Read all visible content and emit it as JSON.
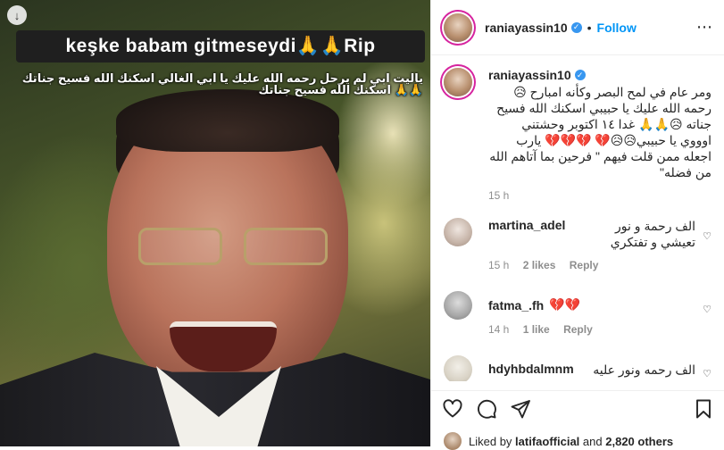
{
  "photo": {
    "banner_text": "keşke babam gitmeseydi🙏🙏Rip",
    "caption_line1": "ياليت ابي لم يرحل رحمه الله عليك يا ابي الغالي اسكنك الله فسيح جناتك",
    "caption_line2": "🙏🙏 اسكنك الله فسيح جناتك",
    "download_icon": "arrow-down-icon"
  },
  "header": {
    "username": "raniayassin10",
    "verified_icon": "verified-badge-icon",
    "separator": "•",
    "follow_label": "Follow",
    "more_icon": "ellipsis-icon"
  },
  "caption": {
    "username": "raniayassin10",
    "text": "ومر عام في لمح البصر وكأنه امبارح 😥رحمه الله عليك يا حبيبي اسكنك الله فسيح جناته 😥🙏🙏 غدا ١٤ اكتوبر وحشتني اوووي يا حبيبي😥😥💔 💔💔💔 يارب اجعله ممن قلت فيهم \" فرحين بما آتاهم الله من فضله\"",
    "time": "15 h"
  },
  "comments": [
    {
      "username": "martina_adel",
      "text": "الف رحمة و نور\nتعيشي و تفتكري",
      "time": "15 h",
      "likes": "2 likes",
      "reply": "Reply"
    },
    {
      "username": "fatma_.fh",
      "text": "💔💔",
      "time": "14 h",
      "likes": "1 like",
      "reply": "Reply"
    },
    {
      "username": "hdyhbdalmnm",
      "text": "الف رحمه ونور عليه"
    }
  ],
  "actions": {
    "like_icon": "heart-icon",
    "comment_icon": "comment-icon",
    "share_icon": "share-icon",
    "save_icon": "bookmark-icon"
  },
  "likes_line": {
    "prefix": "Liked by",
    "user": "latifaofficial",
    "conjunction": "and",
    "others": "2,820 others"
  }
}
